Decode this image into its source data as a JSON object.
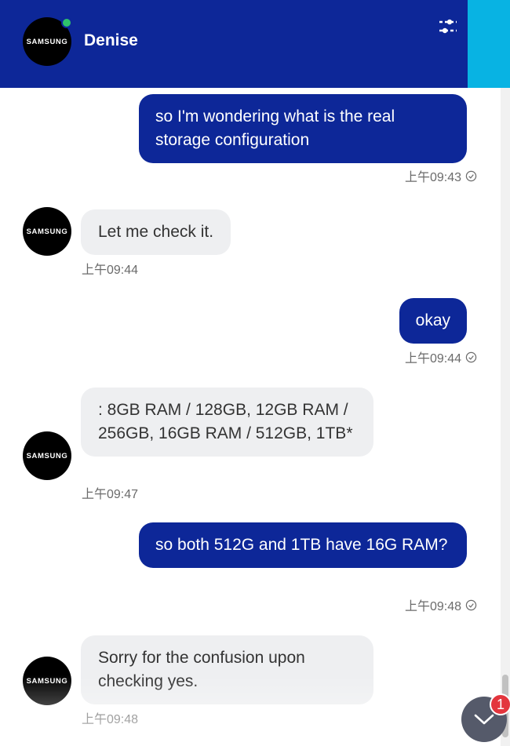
{
  "header": {
    "avatar_text": "SAMSUNG",
    "agent_name": "Denise",
    "settings_icon": "sliders-icon",
    "online_status_color": "#2ec26b",
    "brand_color": "#0d2798",
    "accent_color": "#08b3e3"
  },
  "messages": [
    {
      "sender": "user",
      "text": "so I'm wondering what is the real storage configuration",
      "time": "上午09:43",
      "read": true
    },
    {
      "sender": "agent",
      "avatar_text": "SAMSUNG",
      "text": "Let me check it.",
      "time": "上午09:44"
    },
    {
      "sender": "user",
      "text": "okay",
      "time": "上午09:44",
      "read": true
    },
    {
      "sender": "agent",
      "avatar_text": "SAMSUNG",
      "text": ": 8GB RAM / 128GB, 12GB RAM / 256GB, 16GB RAM / 512GB, 1TB*",
      "time": "上午09:47"
    },
    {
      "sender": "user",
      "text": "so both 512G and 1TB have 16G RAM?",
      "time": "上午09:48",
      "read": true
    },
    {
      "sender": "agent",
      "avatar_text": "SAMSUNG",
      "text": "Sorry for the confusion upon checking yes.",
      "time": "上午09:48"
    }
  ],
  "scroll_button": {
    "icon": "chevron-down-icon",
    "unread_count": "1"
  }
}
